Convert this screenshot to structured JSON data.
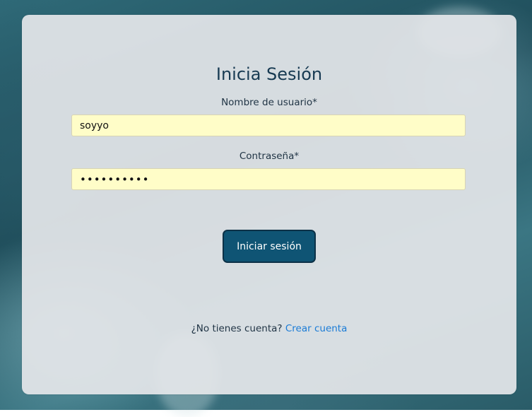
{
  "login": {
    "title": "Inicia Sesión",
    "username_label": "Nombre de usuario*",
    "username_value": "soyyo",
    "password_label": "Contraseña*",
    "password_value": "soyyo12345",
    "submit_label": "Iniciar sesión",
    "signup_prompt": "¿No tienes cuenta?",
    "signup_link": "Crear cuenta"
  },
  "colors": {
    "card_background": "#e4e6ea",
    "input_background": "#fffdc8",
    "button_background": "#0f5474",
    "link_color": "#1a7bd6",
    "title_color": "#173a52"
  }
}
